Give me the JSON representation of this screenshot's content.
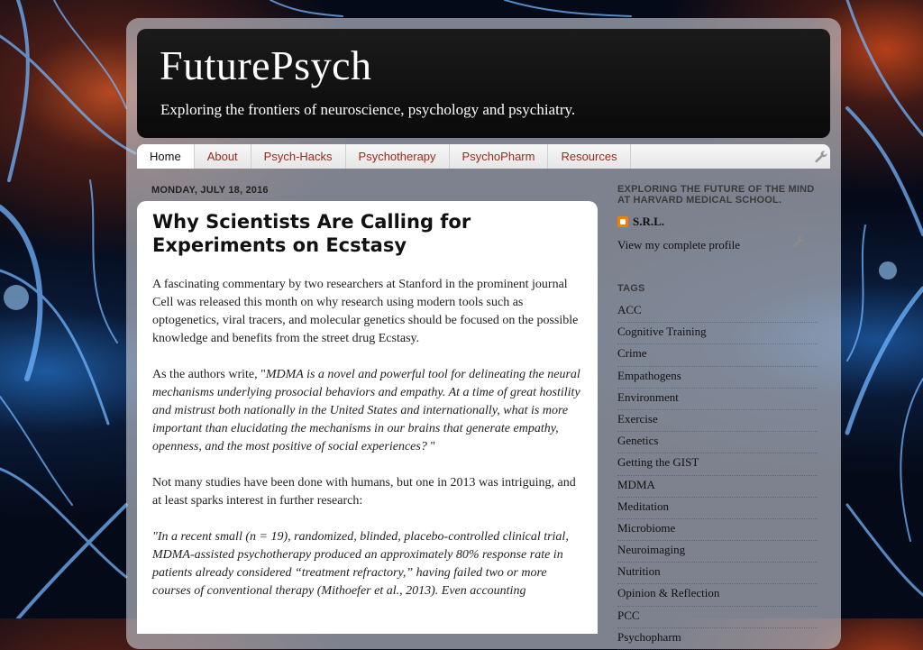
{
  "header": {
    "title": "FuturePsych",
    "tagline": "Exploring the frontiers of neuroscience, psychology and psychiatry."
  },
  "nav": {
    "tabs": [
      {
        "label": "Home"
      },
      {
        "label": "About"
      },
      {
        "label": "Psych-Hacks"
      },
      {
        "label": "Psychotherapy"
      },
      {
        "label": "PsychoPharm"
      },
      {
        "label": "Resources"
      }
    ]
  },
  "post": {
    "date": "MONDAY, JULY 18, 2016",
    "title": "Why Scientists Are Calling for Experiments on Ecstasy",
    "p1": "A fascinating commentary by two researchers at Stanford in the prominent journal Cell was released this month on why research using modern tools such as optogenetics, viral tracers, and molecular genetics should be focused on the possible knowledge and benefits from the street drug Ecstasy.",
    "p2_prefix": "As the authors write, \"",
    "p2_quote": "MDMA is a novel and powerful tool for delineating the neural mechanisms underlying prosocial behaviors and empathy. At a time of great hostility and mistrust both nationally in the United States and internationally, what is more important than elucidating the mechanisms in our brains that generate empathy, openness, and the most positive of social experiences? ",
    "p2_suffix": "\"",
    "p3": "Not many studies have been done with humans, but one in 2013 was intriguing, and at least sparks interest in further research:",
    "p4": "\"In a recent small (n = 19), randomized, blinded, placebo-controlled clinical trial, MDMA-assisted psychotherapy produced an approximately 80% response rate in patients already considered “treatment refractory,” having failed two or more courses of conventional therapy (Mithoefer et al., 2013). Even accounting"
  },
  "sidebar": {
    "profile_heading": "EXPLORING THE FUTURE OF THE MIND AT HARVARD MEDICAL SCHOOL.",
    "profile_name": "S.R.L.",
    "profile_link": "View my complete profile",
    "tags_heading": "TAGS",
    "tags": [
      "ACC",
      "Cognitive Training",
      "Crime",
      "Empathogens",
      "Environment",
      "Exercise",
      "Genetics",
      "Getting the GIST",
      "MDMA",
      "Meditation",
      "Microbiome",
      "Neuroimaging",
      "Nutrition",
      "Opinion & Reflection",
      "PCC",
      "Psychopharm"
    ]
  },
  "colors": {
    "accent": "#9b2a1c",
    "header_bg": "#111111",
    "panel_bg": "#c8cdd7"
  },
  "icons": {
    "nav_tool": "wrench-icon",
    "profile_tool": "wrench-icon",
    "profile": "blogger-icon"
  }
}
